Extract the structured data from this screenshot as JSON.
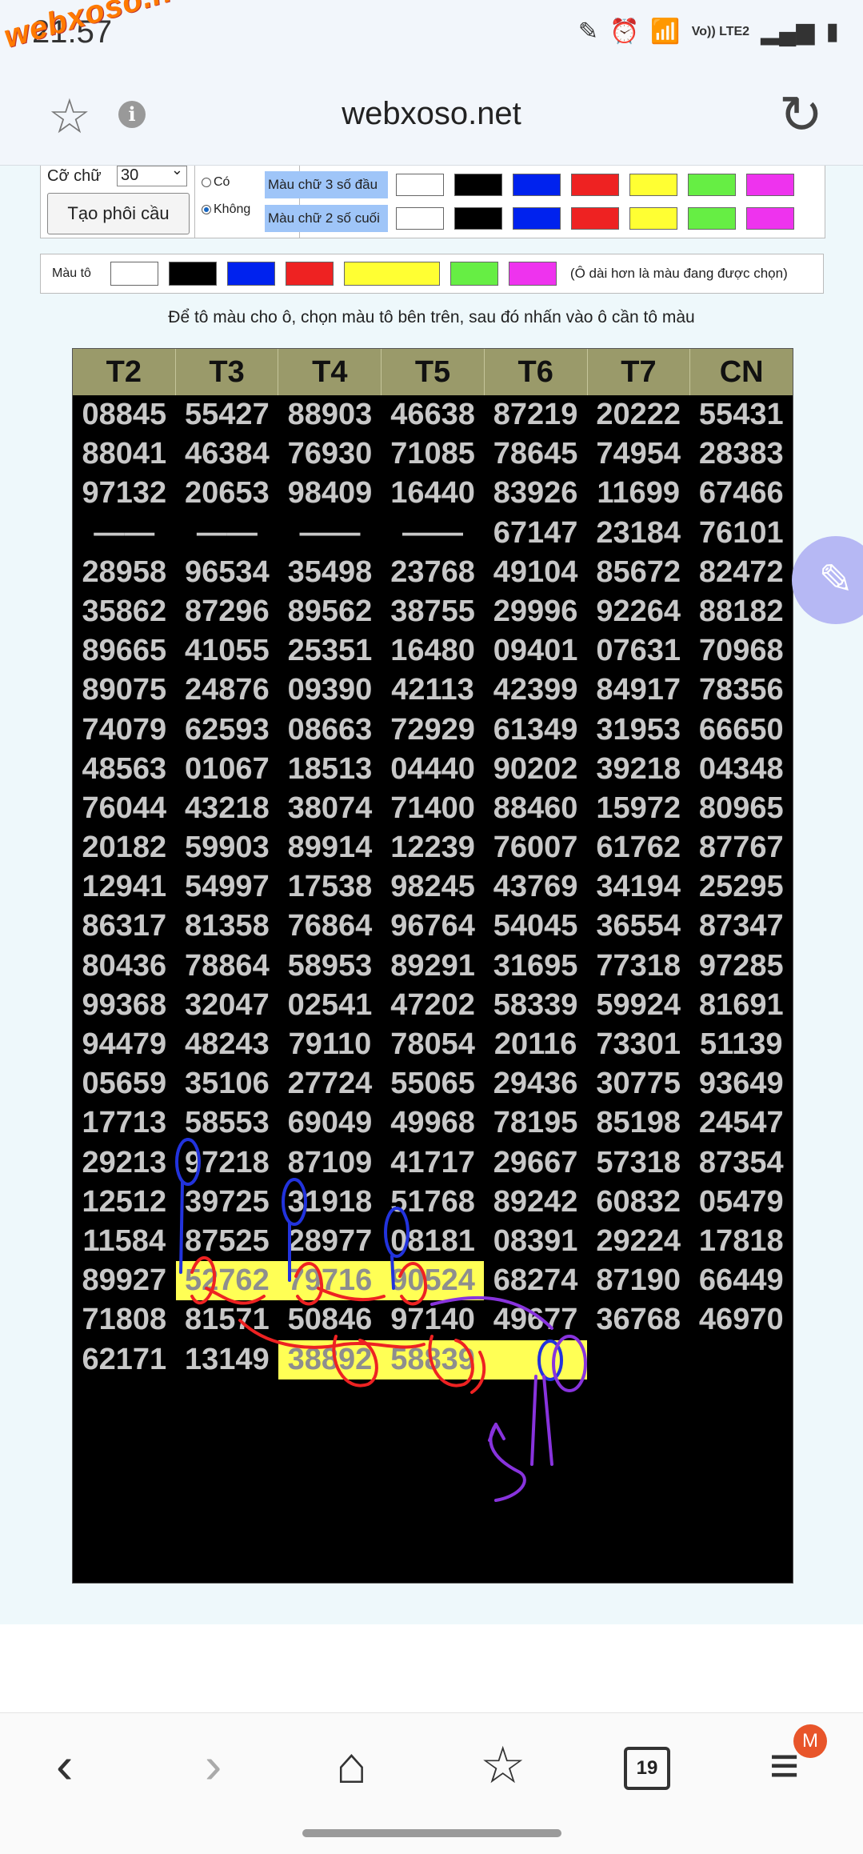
{
  "status_bar": {
    "time": "21:57",
    "network": "Vo)) LTE2",
    "watermark": "webxoso.net"
  },
  "browser": {
    "url": "webxoso.net"
  },
  "config": {
    "font_size_label": "Cỡ chữ",
    "font_size_value": "30",
    "create_button": "Tạo phôi cầu",
    "radio_yes": "Có",
    "radio_no": "Không",
    "row_first3_label": "Màu chữ 3 số đầu",
    "row_last2_label": "Màu chữ 2 số cuối",
    "fill_label": "Màu tô",
    "fill_note": "(Ô dài hơn là màu đang được chọn)",
    "swatches": [
      "#ffffff",
      "#000000",
      "#0022ee",
      "#ee2222",
      "#ffff33",
      "#66ee44",
      "#ee33ee"
    ],
    "selected_fill": "#ffff33"
  },
  "instruction": "Để tô màu cho ô, chọn màu tô bên trên, sau đó nhấn vào ô cần tô màu",
  "table": {
    "headers": [
      "T2",
      "T3",
      "T4",
      "T5",
      "T6",
      "T7",
      "CN"
    ],
    "rows": [
      [
        "08845",
        "55427",
        "88903",
        "46638",
        "87219",
        "20222",
        "55431"
      ],
      [
        "88041",
        "46384",
        "76930",
        "71085",
        "78645",
        "74954",
        "28383"
      ],
      [
        "97132",
        "20653",
        "98409",
        "16440",
        "83926",
        "11699",
        "67466"
      ],
      [
        "——",
        "——",
        "——",
        "——",
        "67147",
        "23184",
        "76101"
      ],
      [
        "28958",
        "96534",
        "35498",
        "23768",
        "49104",
        "85672",
        "82472"
      ],
      [
        "35862",
        "87296",
        "89562",
        "38755",
        "29996",
        "92264",
        "88182"
      ],
      [
        "89665",
        "41055",
        "25351",
        "16480",
        "09401",
        "07631",
        "70968"
      ],
      [
        "89075",
        "24876",
        "09390",
        "42113",
        "42399",
        "84917",
        "78356"
      ],
      [
        "74079",
        "62593",
        "08663",
        "72929",
        "61349",
        "31953",
        "66650"
      ],
      [
        "48563",
        "01067",
        "18513",
        "04440",
        "90202",
        "39218",
        "04348"
      ],
      [
        "76044",
        "43218",
        "38074",
        "71400",
        "88460",
        "15972",
        "80965"
      ],
      [
        "20182",
        "59903",
        "89914",
        "12239",
        "76007",
        "61762",
        "87767"
      ],
      [
        "12941",
        "54997",
        "17538",
        "98245",
        "43769",
        "34194",
        "25295"
      ],
      [
        "86317",
        "81358",
        "76864",
        "96764",
        "54045",
        "36554",
        "87347"
      ],
      [
        "80436",
        "78864",
        "58953",
        "89291",
        "31695",
        "77318",
        "97285"
      ],
      [
        "99368",
        "32047",
        "02541",
        "47202",
        "58339",
        "59924",
        "81691"
      ],
      [
        "94479",
        "48243",
        "79110",
        "78054",
        "20116",
        "73301",
        "51139"
      ],
      [
        "05659",
        "35106",
        "27724",
        "55065",
        "29436",
        "30775",
        "93649"
      ],
      [
        "17713",
        "58553",
        "69049",
        "49968",
        "78195",
        "85198",
        "24547"
      ],
      [
        "29213",
        "97218",
        "87109",
        "41717",
        "29667",
        "57318",
        "87354"
      ],
      [
        "12512",
        "39725",
        "31918",
        "51768",
        "89242",
        "60832",
        "05479"
      ],
      [
        "11584",
        "87525",
        "28977",
        "08181",
        "08391",
        "29224",
        "17818"
      ],
      [
        "89927",
        "52762",
        "79716",
        "90524",
        "68274",
        "87190",
        "66449"
      ],
      [
        "71808",
        "81571",
        "50846",
        "97140",
        "49677",
        "36768",
        "46970"
      ],
      [
        "62171",
        "13149",
        "38892",
        "58839",
        "",
        "",
        ""
      ]
    ],
    "highlighted": [
      [
        22,
        1
      ],
      [
        22,
        2
      ],
      [
        22,
        3
      ],
      [
        24,
        2
      ],
      [
        24,
        3
      ],
      [
        24,
        4
      ]
    ],
    "cell_fill_color": "#ffff55"
  },
  "bottom_nav": {
    "tab_count": "19",
    "avatar_letter": "M"
  }
}
